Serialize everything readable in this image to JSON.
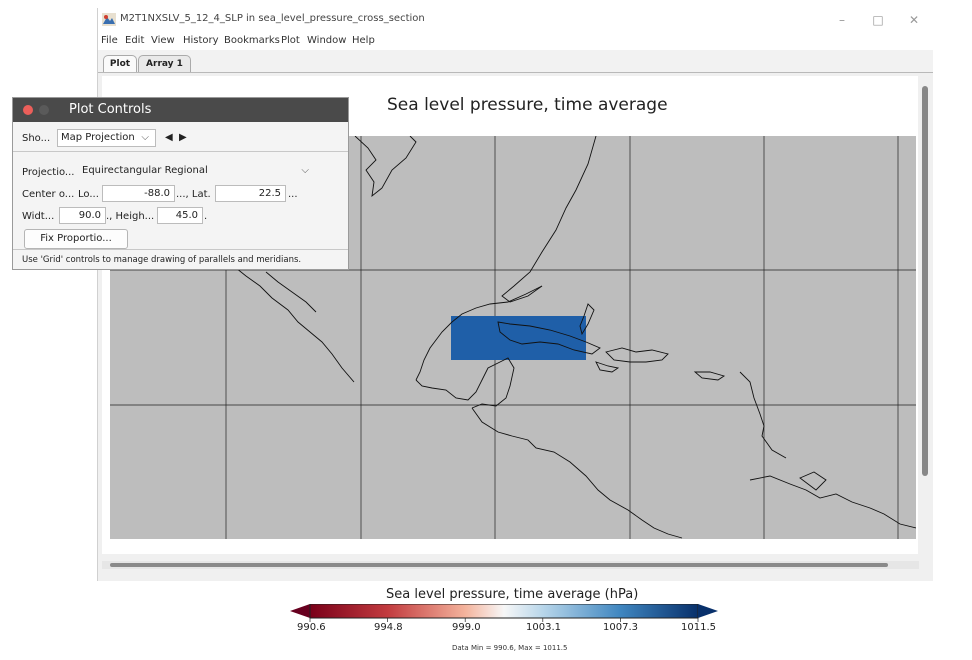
{
  "window": {
    "title": "M2T1NXSLV_5_12_4_SLP in sea_level_pressure_cross_section",
    "controls": {
      "minimize": "–",
      "maximize": "□",
      "close": "✕"
    }
  },
  "menu": [
    "File",
    "Edit",
    "View",
    "History",
    "Bookmarks",
    "Plot",
    "Window",
    "Help"
  ],
  "tabs": [
    {
      "label": "Plot",
      "active": true
    },
    {
      "label": "Array 1",
      "active": false
    }
  ],
  "plot": {
    "title": "Sea level pressure, time average"
  },
  "plot_controls": {
    "title": "Plot Controls",
    "show_label": "Sho...",
    "show_select": "Map Projection",
    "prev_arrow": "◀",
    "next_arrow": "▶",
    "projection_label": "Projectio...",
    "projection_value": "Equirectangular Regional",
    "center_label": "Center o...",
    "lon_label": "Lo...",
    "lon_value": "-88.0",
    "lon_after": "..., Lat.",
    "lat_value": "22.5",
    "lat_after": "...",
    "width_label": "Widt...",
    "width_value": "90.0",
    "height_label": "., Heigh...",
    "height_value": "45.0",
    "height_after": ".",
    "fix_button": "Fix Proportio...",
    "hint": "Use 'Grid' controls to manage drawing of parallels and meridians."
  },
  "colorbar": {
    "title": "Sea level pressure, time average (hPa)",
    "ticks": [
      "990.6",
      "994.8",
      "999.0",
      "1003.1",
      "1007.3",
      "1011.5"
    ],
    "data_range": "Data Min = 990.6, Max = 1011.5"
  },
  "colors": {
    "map_bg": "#bdbdbd",
    "low": "#7a0019",
    "high": "#08306b",
    "titlebar_dark": "#4a4a4a"
  },
  "icons": {
    "app": "panoply-globe-icon",
    "chevron": "chevron-down-icon",
    "close_dot": "close-dot-icon"
  }
}
